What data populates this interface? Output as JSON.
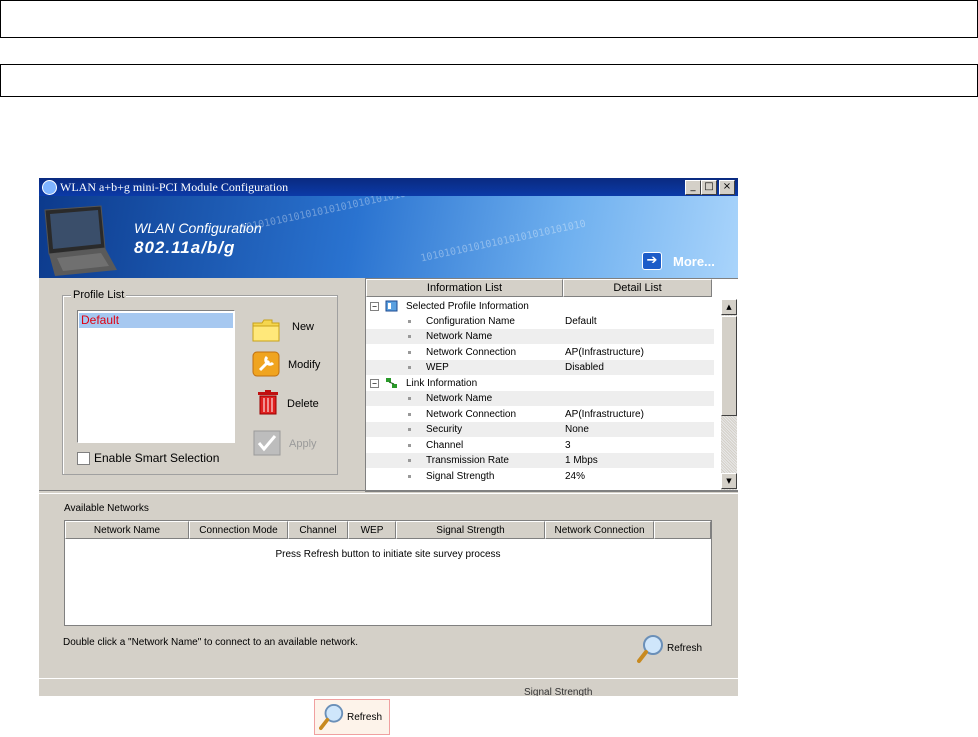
{
  "window": {
    "title": "WLAN a+b+g mini-PCI Module Configuration",
    "controls": [
      "_",
      "□",
      "×"
    ]
  },
  "banner": {
    "line1": "WLAN Configuration",
    "line2": "802.11a/b/g",
    "more_label": "More...",
    "binary_text": "1010101010101010101010101010"
  },
  "profile": {
    "group_label": "Profile List",
    "items": [
      "Default"
    ],
    "smart_selection_label": "Enable Smart Selection",
    "buttons": {
      "new": "New",
      "modify": "Modify",
      "delete": "Delete",
      "apply": "Apply"
    }
  },
  "info": {
    "tabs": [
      "Information List",
      "Detail List"
    ],
    "sections": [
      {
        "title": "Selected Profile Information",
        "rows": [
          {
            "key": "Configuration Name",
            "value": "Default"
          },
          {
            "key": "Network Name",
            "value": ""
          },
          {
            "key": "Network Connection",
            "value": "AP(Infrastructure)"
          },
          {
            "key": "WEP",
            "value": "Disabled"
          }
        ]
      },
      {
        "title": "Link Information",
        "rows": [
          {
            "key": "Network Name",
            "value": ""
          },
          {
            "key": "Network Connection",
            "value": "AP(Infrastructure)"
          },
          {
            "key": "Security",
            "value": "None"
          },
          {
            "key": "Channel",
            "value": "3"
          },
          {
            "key": "Transmission Rate",
            "value": "1 Mbps"
          },
          {
            "key": "Signal Strength",
            "value": "24%"
          }
        ]
      }
    ]
  },
  "available": {
    "label": "Available Networks",
    "columns": [
      "Network Name",
      "Connection Mode",
      "Channel",
      "WEP",
      "Signal Strength",
      "Network Connection"
    ],
    "empty_message": "Press Refresh button to initiate site survey process",
    "hint": "Double click a \"Network Name\" to connect to an available network.",
    "refresh_label": "Refresh"
  },
  "status": {
    "signal_label": "Signal Strength"
  },
  "refresh_legend": {
    "label": "Refresh"
  }
}
